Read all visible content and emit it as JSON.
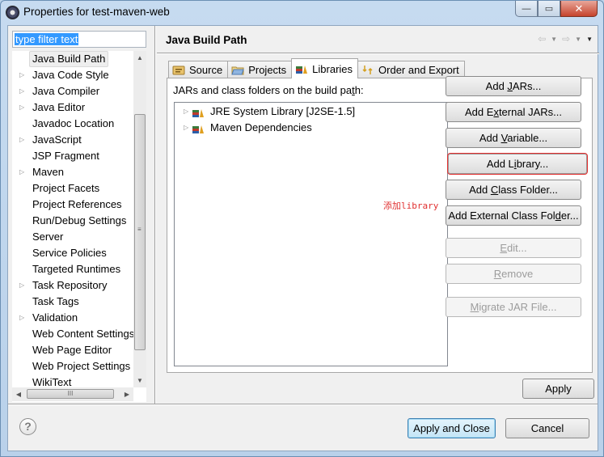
{
  "window": {
    "title": "Properties for test-maven-web",
    "controls": {
      "minimize": "—",
      "maximize": "▭",
      "close": "✕"
    }
  },
  "filter": {
    "value": "type filter text"
  },
  "sidebar": {
    "items": [
      {
        "label": "Java Build Path",
        "expandable": false,
        "selected": true
      },
      {
        "label": "Java Code Style",
        "expandable": true
      },
      {
        "label": "Java Compiler",
        "expandable": true
      },
      {
        "label": "Java Editor",
        "expandable": true
      },
      {
        "label": "Javadoc Location",
        "expandable": false
      },
      {
        "label": "JavaScript",
        "expandable": true
      },
      {
        "label": "JSP Fragment",
        "expandable": false
      },
      {
        "label": "Maven",
        "expandable": true
      },
      {
        "label": "Project Facets",
        "expandable": false
      },
      {
        "label": "Project References",
        "expandable": false
      },
      {
        "label": "Run/Debug Settings",
        "expandable": false
      },
      {
        "label": "Server",
        "expandable": false
      },
      {
        "label": "Service Policies",
        "expandable": false
      },
      {
        "label": "Targeted Runtimes",
        "expandable": false
      },
      {
        "label": "Task Repository",
        "expandable": true
      },
      {
        "label": "Task Tags",
        "expandable": false
      },
      {
        "label": "Validation",
        "expandable": true
      },
      {
        "label": "Web Content Settings",
        "expandable": false
      },
      {
        "label": "Web Page Editor",
        "expandable": false
      },
      {
        "label": "Web Project Settings",
        "expandable": false
      },
      {
        "label": "WikiText",
        "expandable": false
      }
    ],
    "scroll_grip": "≡",
    "hscroll_grip": "III"
  },
  "page": {
    "title": "Java Build Path",
    "tabs": [
      {
        "label": "Source",
        "icon": "source-folder-icon",
        "active": false
      },
      {
        "label": "Projects",
        "icon": "projects-folder-icon",
        "active": false
      },
      {
        "label": "Libraries",
        "icon": "libraries-icon",
        "active": true
      },
      {
        "label": "Order and Export",
        "icon": "order-export-icon",
        "active": false
      }
    ],
    "panel_label_pre": "JARs and class folders on the build pa",
    "panel_label_mn": "t",
    "panel_label_post": "h:",
    "libraries": [
      {
        "label": "JRE System Library [J2SE-1.5]"
      },
      {
        "label": "Maven Dependencies"
      }
    ],
    "annotation": "添加library",
    "buttons": [
      {
        "pre": "Add ",
        "mn": "J",
        "post": "ARs...",
        "enabled": true
      },
      {
        "pre": "Add E",
        "mn": "x",
        "post": "ternal JARs...",
        "enabled": true
      },
      {
        "pre": "Add ",
        "mn": "V",
        "post": "ariable...",
        "enabled": true
      },
      {
        "pre": "Add L",
        "mn": "i",
        "post": "brary...",
        "enabled": true,
        "highlighted": true
      },
      {
        "pre": "Add ",
        "mn": "C",
        "post": "lass Folder...",
        "enabled": true
      },
      {
        "pre": "Add External Class Fol",
        "mn": "d",
        "post": "er...",
        "enabled": true
      },
      {
        "pre": "",
        "mn": "E",
        "post": "dit...",
        "enabled": false
      },
      {
        "pre": "",
        "mn": "R",
        "post": "emove",
        "enabled": false
      },
      {
        "pre": "",
        "mn": "M",
        "post": "igrate JAR File...",
        "enabled": false
      }
    ],
    "apply_label": "Apply"
  },
  "footer": {
    "help": "?",
    "apply_close_label": "Apply and Close",
    "cancel_label": "Cancel"
  },
  "colors": {
    "selection": "#3399ff",
    "annotation": "#e03030",
    "default_button_border": "#3c7fb1"
  }
}
